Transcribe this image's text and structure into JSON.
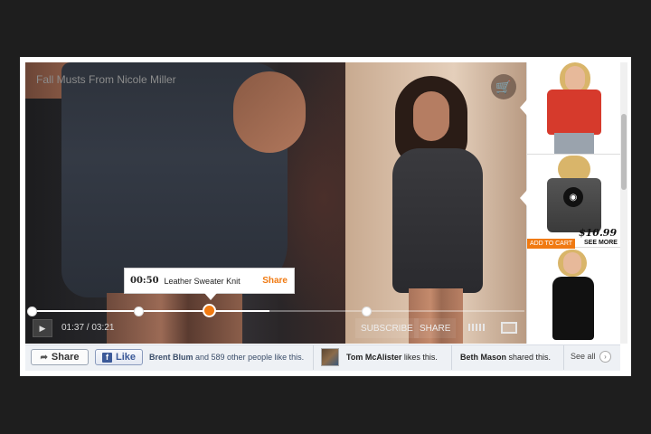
{
  "video": {
    "title": "Fall Musts From Nicole Miller",
    "time_display": "01:37 / 03:21",
    "progress": 0.48,
    "subscribe_label": "SUBSCRIBE",
    "share_label": "SHARE",
    "cart_icon": "cart-icon",
    "play_icon": "play-icon",
    "fullscreen_icon": "fullscreen-icon",
    "volume_icon": "volume-icon"
  },
  "tooltip": {
    "time": "00:50",
    "title": "Leather  Sweater Knit",
    "share_label": "Share"
  },
  "products": [
    {
      "name": "red-off-shoulder-top"
    },
    {
      "name": "grey-drape-top",
      "price": "$10.99",
      "add_to_cart_label": "ADD TO CART",
      "see_more_label": "SEE MORE",
      "icon": "camera-icon"
    },
    {
      "name": "black-lace-dress"
    }
  ],
  "social": {
    "share_label": "Share",
    "like_label": "Like",
    "likes_text_name": "Brent Blum",
    "likes_text_rest": " and 589 other people like this.",
    "tom_name": "Tom McAlister",
    "tom_action": " likes this.",
    "beth_name": "Beth Mason",
    "beth_action": " shared this.",
    "see_all_label": "See all"
  },
  "colors": {
    "accent": "#f07a12",
    "facebook": "#3b5998"
  }
}
